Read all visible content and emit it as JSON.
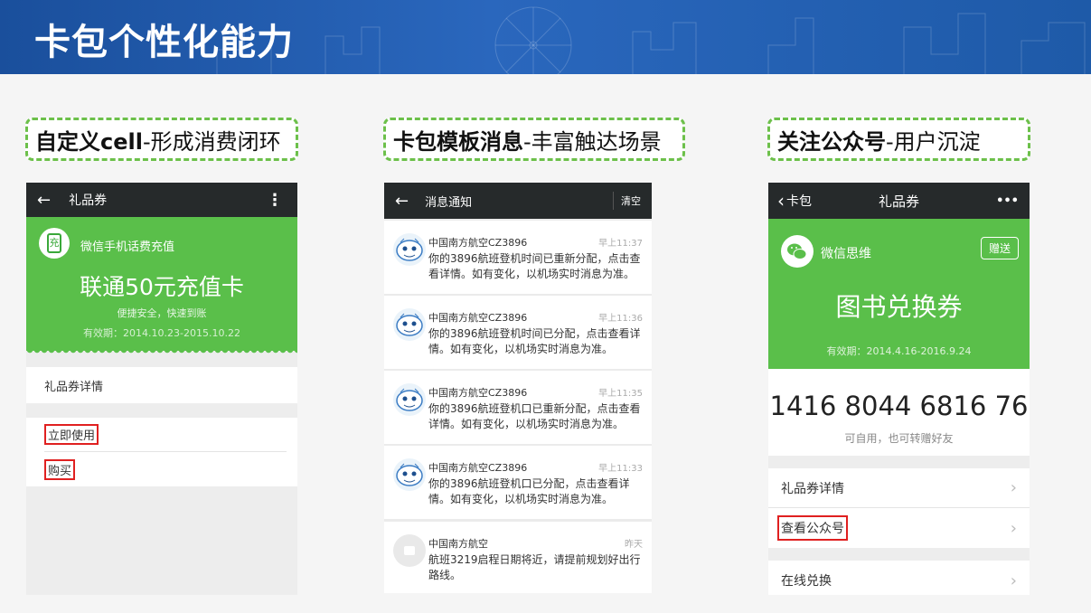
{
  "slide_title": "卡包个性化能力",
  "tags": [
    {
      "bold": "自定义cell",
      "rest": "-形成消费闭环"
    },
    {
      "bold": "卡包模板消息",
      "rest": "-丰富触达场景"
    },
    {
      "bold": "关注公众号",
      "rest": "-用户沉淀"
    }
  ],
  "phone1": {
    "topbar": {
      "back_icon": "←",
      "title": "礼品券",
      "more_icon": "⋮"
    },
    "card": {
      "logo_char": "充",
      "merchant": "微信手机话费充值",
      "title": "联通50元充值卡",
      "subtitle": "便捷安全，快速到账",
      "validity": "有效期：2014.10.23-2015.10.22"
    },
    "detail_label": "礼品券详情",
    "use_now": "立即使用",
    "buy": "购买"
  },
  "phone2": {
    "topbar": {
      "back_icon": "←",
      "title": "消息通知",
      "clear": "清空"
    },
    "messages": [
      {
        "from": "中国南方航空CZ3896",
        "time": "早上11:37",
        "body": "你的3896航班登机时间已重新分配，点击查看详情。如有变化，以机场实时消息为准。"
      },
      {
        "from": "中国南方航空CZ3896",
        "time": "早上11:36",
        "body": "你的3896航班登机时间已分配，点击查看详情。如有变化，以机场实时消息为准。"
      },
      {
        "from": "中国南方航空CZ3896",
        "time": "早上11:35",
        "body": "你的3896航班登机口已重新分配，点击查看详情。如有变化，以机场实时消息为准。"
      },
      {
        "from": "中国南方航空CZ3896",
        "time": "早上11:33",
        "body": "你的3896航班登机口已分配，点击查看详情。如有变化，以机场实时消息为准。"
      },
      {
        "from": "中国南方航空",
        "time": "昨天",
        "body": "航班3219启程日期将近，请提前规划好出行路线。"
      }
    ]
  },
  "phone3": {
    "topbar": {
      "back_label": "卡包",
      "title": "礼品券",
      "more_icon": "•••"
    },
    "card": {
      "merchant": "微信思维",
      "gift_button": "赠送",
      "title": "图书兑换券",
      "validity": "有效期：2014.4.16-2016.9.24"
    },
    "code": "1416 8044 6816 76",
    "code_note": "可自用，也可转赠好友",
    "rows": [
      "礼品券详情",
      "查看公众号",
      "在线兑换"
    ]
  },
  "colors": {
    "accent_green": "#5abf4a",
    "dashed_green": "#6cc04a",
    "banner_blue": "#1f5aa8",
    "highlight_red": "#e02020"
  }
}
